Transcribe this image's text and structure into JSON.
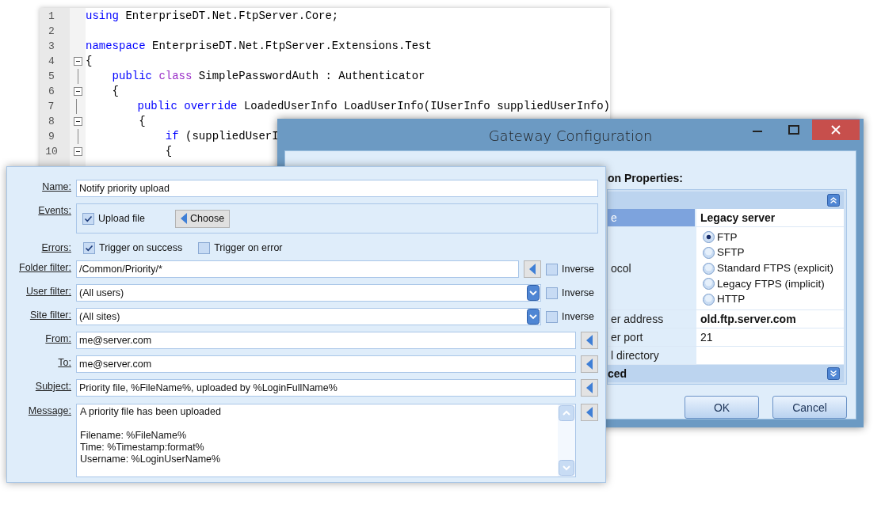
{
  "code_editor": {
    "lines": [
      {
        "number": "1",
        "fold": false,
        "tokens": [
          {
            "kind": "keyword",
            "text": "using"
          },
          {
            "kind": "plain",
            "text": " EnterpriseDT.Net.FtpServer.Core;"
          }
        ]
      },
      {
        "number": "2",
        "fold": false
      },
      {
        "number": "3",
        "fold": false,
        "tokens": [
          {
            "kind": "keyword",
            "text": "namespace"
          },
          {
            "kind": "plain",
            "text": " EnterpriseDT.Net.FtpServer.Extensions.Test"
          }
        ]
      },
      {
        "number": "4",
        "fold": true,
        "tokens": [
          {
            "kind": "plain",
            "text": "{"
          }
        ]
      },
      {
        "number": "5",
        "fold": false,
        "tokens": [
          {
            "kind": "keyword",
            "text": "    public"
          },
          {
            "kind": "declaration",
            "text": " class"
          },
          {
            "kind": "plain",
            "text": " SimplePasswordAuth : Authenticator"
          }
        ]
      },
      {
        "number": "6",
        "fold": true,
        "tokens": [
          {
            "kind": "plain",
            "text": "    {"
          }
        ]
      },
      {
        "number": "7",
        "fold": false,
        "tokens": [
          {
            "kind": "keyword",
            "text": "        public override"
          },
          {
            "kind": "plain",
            "text": " LoadedUserInfo LoadUserInfo(IUserInfo suppliedUserInfo)"
          }
        ]
      },
      {
        "number": "8",
        "fold": true,
        "tokens": [
          {
            "kind": "plain",
            "text": "        {"
          }
        ]
      },
      {
        "number": "9",
        "fold": false,
        "tokens": [
          {
            "kind": "keyword",
            "text": "            if"
          },
          {
            "kind": "plain",
            "text": " (suppliedUserI"
          }
        ]
      },
      {
        "number": "10",
        "fold": true,
        "tokens": [
          {
            "kind": "plain",
            "text": "            {"
          }
        ]
      }
    ]
  },
  "gateway": {
    "title": "Gateway Configuration",
    "heading": "on Properties:",
    "grid": {
      "top_section": {
        "expanded": true
      },
      "rows": [
        {
          "kind": "text",
          "label": "e",
          "value": "Legacy server",
          "bold": true,
          "selected": true
        },
        {
          "kind": "radio",
          "label": "ocol",
          "options": [
            {
              "label": "FTP",
              "selected": true
            },
            {
              "label": "SFTP",
              "selected": false
            },
            {
              "label": "Standard FTPS (explicit)",
              "selected": false
            },
            {
              "label": "Legacy FTPS (implicit)",
              "selected": false
            },
            {
              "label": "HTTP",
              "selected": false
            }
          ]
        },
        {
          "kind": "text",
          "label": "er address",
          "value": "old.ftp.server.com",
          "bold": true,
          "selected": false
        },
        {
          "kind": "text",
          "label": "er port",
          "value": "21",
          "bold": false,
          "selected": false
        },
        {
          "kind": "text",
          "label": "l directory",
          "selected": false
        }
      ],
      "bottom_section": {
        "title": "ced",
        "expanded": false
      }
    },
    "buttons": [
      "OK",
      "Cancel"
    ]
  },
  "form": {
    "fields": [
      {
        "kind": "text",
        "label": "Name:",
        "value": "Notify priority upload"
      },
      {
        "kind": "events",
        "label": "Events:",
        "checkbox": {
          "label": "Upload file",
          "checked": true
        },
        "button": "Choose"
      },
      {
        "kind": "checks",
        "label": "Errors:",
        "options": [
          {
            "label": "Trigger on success",
            "checked": true
          },
          {
            "label": "Trigger on error",
            "checked": false
          }
        ]
      },
      {
        "kind": "filter",
        "label": "Folder filter:",
        "value": "/Common/Priority/*",
        "inverse": {
          "label": "Inverse",
          "checked": false
        }
      },
      {
        "kind": "combo",
        "label": "User filter:",
        "value": "(All users)",
        "inverse": {
          "label": "Inverse",
          "checked": false
        }
      },
      {
        "kind": "combo",
        "label": "Site filter:",
        "value": "(All sites)",
        "inverse": {
          "label": "Inverse",
          "checked": false
        }
      },
      {
        "kind": "insert",
        "label": "From:",
        "value": "me@server.com"
      },
      {
        "kind": "insert",
        "label": "To:",
        "value": "me@server.com"
      },
      {
        "kind": "insert",
        "label": "Subject:",
        "value": "Priority file, %FileName%, uploaded by %LoginFullName%"
      },
      {
        "kind": "message",
        "label": "Message:",
        "value": "A priority file has been uploaded\n\nFilename: %FileName%\nTime: %Timestamp:format%\nUsername: %LoginUserName%"
      }
    ]
  }
}
